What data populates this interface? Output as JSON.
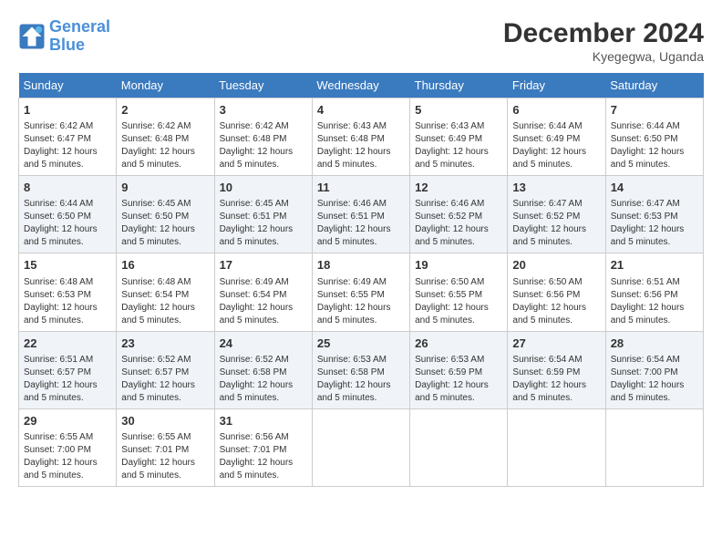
{
  "logo": {
    "line1": "General",
    "line2": "Blue"
  },
  "title": "December 2024",
  "location": "Kyegegwa, Uganda",
  "days_of_week": [
    "Sunday",
    "Monday",
    "Tuesday",
    "Wednesday",
    "Thursday",
    "Friday",
    "Saturday"
  ],
  "weeks": [
    [
      {
        "day": 1,
        "info": "Sunrise: 6:42 AM\nSunset: 6:47 PM\nDaylight: 12 hours\nand 5 minutes."
      },
      {
        "day": 2,
        "info": "Sunrise: 6:42 AM\nSunset: 6:48 PM\nDaylight: 12 hours\nand 5 minutes."
      },
      {
        "day": 3,
        "info": "Sunrise: 6:42 AM\nSunset: 6:48 PM\nDaylight: 12 hours\nand 5 minutes."
      },
      {
        "day": 4,
        "info": "Sunrise: 6:43 AM\nSunset: 6:48 PM\nDaylight: 12 hours\nand 5 minutes."
      },
      {
        "day": 5,
        "info": "Sunrise: 6:43 AM\nSunset: 6:49 PM\nDaylight: 12 hours\nand 5 minutes."
      },
      {
        "day": 6,
        "info": "Sunrise: 6:44 AM\nSunset: 6:49 PM\nDaylight: 12 hours\nand 5 minutes."
      },
      {
        "day": 7,
        "info": "Sunrise: 6:44 AM\nSunset: 6:50 PM\nDaylight: 12 hours\nand 5 minutes."
      }
    ],
    [
      {
        "day": 8,
        "info": "Sunrise: 6:44 AM\nSunset: 6:50 PM\nDaylight: 12 hours\nand 5 minutes."
      },
      {
        "day": 9,
        "info": "Sunrise: 6:45 AM\nSunset: 6:50 PM\nDaylight: 12 hours\nand 5 minutes."
      },
      {
        "day": 10,
        "info": "Sunrise: 6:45 AM\nSunset: 6:51 PM\nDaylight: 12 hours\nand 5 minutes."
      },
      {
        "day": 11,
        "info": "Sunrise: 6:46 AM\nSunset: 6:51 PM\nDaylight: 12 hours\nand 5 minutes."
      },
      {
        "day": 12,
        "info": "Sunrise: 6:46 AM\nSunset: 6:52 PM\nDaylight: 12 hours\nand 5 minutes."
      },
      {
        "day": 13,
        "info": "Sunrise: 6:47 AM\nSunset: 6:52 PM\nDaylight: 12 hours\nand 5 minutes."
      },
      {
        "day": 14,
        "info": "Sunrise: 6:47 AM\nSunset: 6:53 PM\nDaylight: 12 hours\nand 5 minutes."
      }
    ],
    [
      {
        "day": 15,
        "info": "Sunrise: 6:48 AM\nSunset: 6:53 PM\nDaylight: 12 hours\nand 5 minutes."
      },
      {
        "day": 16,
        "info": "Sunrise: 6:48 AM\nSunset: 6:54 PM\nDaylight: 12 hours\nand 5 minutes."
      },
      {
        "day": 17,
        "info": "Sunrise: 6:49 AM\nSunset: 6:54 PM\nDaylight: 12 hours\nand 5 minutes."
      },
      {
        "day": 18,
        "info": "Sunrise: 6:49 AM\nSunset: 6:55 PM\nDaylight: 12 hours\nand 5 minutes."
      },
      {
        "day": 19,
        "info": "Sunrise: 6:50 AM\nSunset: 6:55 PM\nDaylight: 12 hours\nand 5 minutes."
      },
      {
        "day": 20,
        "info": "Sunrise: 6:50 AM\nSunset: 6:56 PM\nDaylight: 12 hours\nand 5 minutes."
      },
      {
        "day": 21,
        "info": "Sunrise: 6:51 AM\nSunset: 6:56 PM\nDaylight: 12 hours\nand 5 minutes."
      }
    ],
    [
      {
        "day": 22,
        "info": "Sunrise: 6:51 AM\nSunset: 6:57 PM\nDaylight: 12 hours\nand 5 minutes."
      },
      {
        "day": 23,
        "info": "Sunrise: 6:52 AM\nSunset: 6:57 PM\nDaylight: 12 hours\nand 5 minutes."
      },
      {
        "day": 24,
        "info": "Sunrise: 6:52 AM\nSunset: 6:58 PM\nDaylight: 12 hours\nand 5 minutes."
      },
      {
        "day": 25,
        "info": "Sunrise: 6:53 AM\nSunset: 6:58 PM\nDaylight: 12 hours\nand 5 minutes."
      },
      {
        "day": 26,
        "info": "Sunrise: 6:53 AM\nSunset: 6:59 PM\nDaylight: 12 hours\nand 5 minutes."
      },
      {
        "day": 27,
        "info": "Sunrise: 6:54 AM\nSunset: 6:59 PM\nDaylight: 12 hours\nand 5 minutes."
      },
      {
        "day": 28,
        "info": "Sunrise: 6:54 AM\nSunset: 7:00 PM\nDaylight: 12 hours\nand 5 minutes."
      }
    ],
    [
      {
        "day": 29,
        "info": "Sunrise: 6:55 AM\nSunset: 7:00 PM\nDaylight: 12 hours\nand 5 minutes."
      },
      {
        "day": 30,
        "info": "Sunrise: 6:55 AM\nSunset: 7:01 PM\nDaylight: 12 hours\nand 5 minutes."
      },
      {
        "day": 31,
        "info": "Sunrise: 6:56 AM\nSunset: 7:01 PM\nDaylight: 12 hours\nand 5 minutes."
      },
      null,
      null,
      null,
      null
    ]
  ]
}
